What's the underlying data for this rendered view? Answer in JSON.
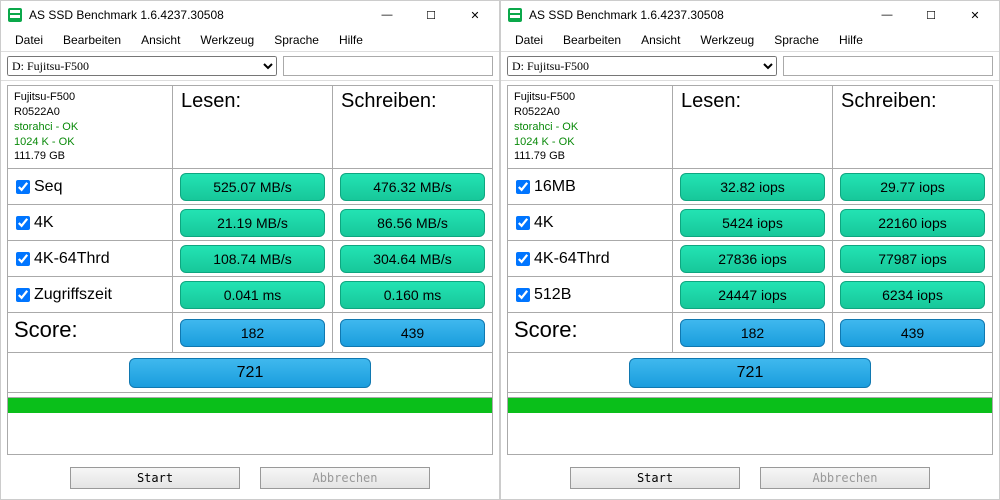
{
  "title": "AS SSD Benchmark 1.6.4237.30508",
  "menu": {
    "datei": "Datei",
    "bearbeiten": "Bearbeiten",
    "ansicht": "Ansicht",
    "werkzeug": "Werkzeug",
    "sprache": "Sprache",
    "hilfe": "Hilfe"
  },
  "drive_select": "D: Fujitsu-F500",
  "info": {
    "model": "Fujitsu-F500",
    "fw": "R0522A0",
    "driver": "storahci - OK",
    "align": "1024 K - OK",
    "size": "111.79 GB"
  },
  "head": {
    "read": "Lesen:",
    "write": "Schreiben:"
  },
  "left": {
    "rows": [
      {
        "label": "Seq",
        "read": "525.07 MB/s",
        "write": "476.32 MB/s"
      },
      {
        "label": "4K",
        "read": "21.19 MB/s",
        "write": "86.56 MB/s"
      },
      {
        "label": "4K-64Thrd",
        "read": "108.74 MB/s",
        "write": "304.64 MB/s"
      },
      {
        "label": "Zugriffszeit",
        "read": "0.041 ms",
        "write": "0.160 ms"
      }
    ]
  },
  "right": {
    "rows": [
      {
        "label": "16MB",
        "read": "32.82 iops",
        "write": "29.77 iops"
      },
      {
        "label": "4K",
        "read": "5424 iops",
        "write": "22160 iops"
      },
      {
        "label": "4K-64Thrd",
        "read": "27836 iops",
        "write": "77987 iops"
      },
      {
        "label": "512B",
        "read": "24447 iops",
        "write": "6234 iops"
      }
    ]
  },
  "score": {
    "label": "Score:",
    "read": "182",
    "write": "439",
    "total": "721"
  },
  "buttons": {
    "start": "Start",
    "abort": "Abbrechen"
  },
  "chart_data": [
    {
      "type": "table",
      "title": "AS SSD Benchmark — MB/s view",
      "drive": "Fujitsu-F500 111.79 GB",
      "series": [
        {
          "name": "Lesen (read)",
          "categories": [
            "Seq",
            "4K",
            "4K-64Thrd",
            "Zugriffszeit"
          ],
          "values": [
            525.07,
            21.19,
            108.74,
            0.041
          ],
          "units": [
            "MB/s",
            "MB/s",
            "MB/s",
            "ms"
          ]
        },
        {
          "name": "Schreiben (write)",
          "categories": [
            "Seq",
            "4K",
            "4K-64Thrd",
            "Zugriffszeit"
          ],
          "values": [
            476.32,
            86.56,
            304.64,
            0.16
          ],
          "units": [
            "MB/s",
            "MB/s",
            "MB/s",
            "ms"
          ]
        }
      ],
      "score": {
        "read": 182,
        "write": 439,
        "total": 721
      }
    },
    {
      "type": "table",
      "title": "AS SSD Benchmark — IOPS view",
      "drive": "Fujitsu-F500 111.79 GB",
      "series": [
        {
          "name": "Lesen (read)",
          "categories": [
            "16MB",
            "4K",
            "4K-64Thrd",
            "512B"
          ],
          "values": [
            32.82,
            5424,
            27836,
            24447
          ],
          "units": [
            "iops",
            "iops",
            "iops",
            "iops"
          ]
        },
        {
          "name": "Schreiben (write)",
          "categories": [
            "16MB",
            "4K",
            "4K-64Thrd",
            "512B"
          ],
          "values": [
            29.77,
            22160,
            77987,
            6234
          ],
          "units": [
            "iops",
            "iops",
            "iops",
            "iops"
          ]
        }
      ],
      "score": {
        "read": 182,
        "write": 439,
        "total": 721
      }
    }
  ]
}
